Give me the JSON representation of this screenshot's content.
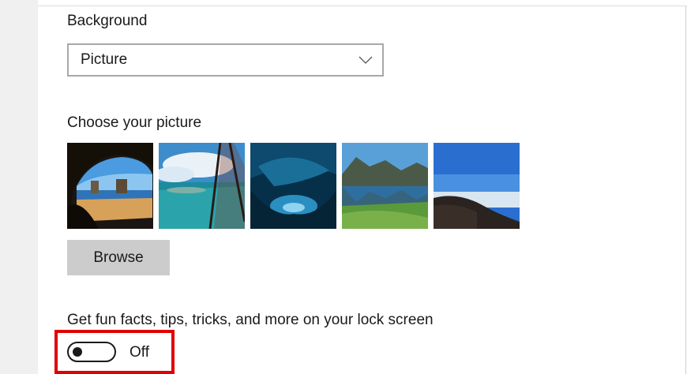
{
  "background": {
    "label": "Background",
    "dropdown_value": "Picture"
  },
  "picture": {
    "label": "Choose your picture",
    "thumbnails": [
      {
        "name": "cave-beach"
      },
      {
        "name": "ocean-cliffs"
      },
      {
        "name": "ice-cave"
      },
      {
        "name": "mountain-lake"
      },
      {
        "name": "hilltop-sky"
      }
    ],
    "browse_label": "Browse"
  },
  "facts": {
    "label": "Get fun facts, tips, tricks, and more on your lock screen",
    "toggle_state": "Off"
  },
  "colors": {
    "highlight": "#e00000",
    "button_bg": "#cccccc"
  }
}
